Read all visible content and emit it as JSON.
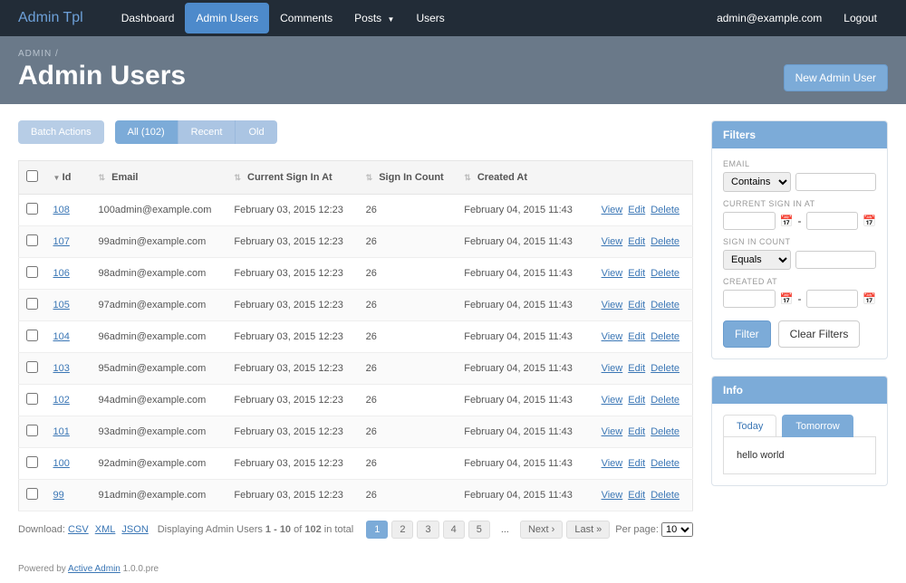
{
  "nav": {
    "brand": "Admin Tpl",
    "items": [
      "Dashboard",
      "Admin Users",
      "Comments",
      "Posts",
      "Users"
    ],
    "active": 1,
    "dropdown_index": 3,
    "user_email": "admin@example.com",
    "logout": "Logout"
  },
  "header": {
    "breadcrumb": "ADMIN  /",
    "title": "Admin Users",
    "new_btn": "New Admin User"
  },
  "scopes": {
    "batch": "Batch Actions",
    "items": [
      "All (102)",
      "Recent",
      "Old"
    ],
    "active": 0
  },
  "table": {
    "cols": [
      "",
      "Id",
      "Email",
      "Current Sign In At",
      "Sign In Count",
      "Created At",
      ""
    ],
    "rows": [
      {
        "id": "108",
        "email": "100admin@example.com",
        "signin_at": "February 03, 2015 12:23",
        "count": "26",
        "created": "February 04, 2015 11:43"
      },
      {
        "id": "107",
        "email": "99admin@example.com",
        "signin_at": "February 03, 2015 12:23",
        "count": "26",
        "created": "February 04, 2015 11:43"
      },
      {
        "id": "106",
        "email": "98admin@example.com",
        "signin_at": "February 03, 2015 12:23",
        "count": "26",
        "created": "February 04, 2015 11:43"
      },
      {
        "id": "105",
        "email": "97admin@example.com",
        "signin_at": "February 03, 2015 12:23",
        "count": "26",
        "created": "February 04, 2015 11:43"
      },
      {
        "id": "104",
        "email": "96admin@example.com",
        "signin_at": "February 03, 2015 12:23",
        "count": "26",
        "created": "February 04, 2015 11:43"
      },
      {
        "id": "103",
        "email": "95admin@example.com",
        "signin_at": "February 03, 2015 12:23",
        "count": "26",
        "created": "February 04, 2015 11:43"
      },
      {
        "id": "102",
        "email": "94admin@example.com",
        "signin_at": "February 03, 2015 12:23",
        "count": "26",
        "created": "February 04, 2015 11:43"
      },
      {
        "id": "101",
        "email": "93admin@example.com",
        "signin_at": "February 03, 2015 12:23",
        "count": "26",
        "created": "February 04, 2015 11:43"
      },
      {
        "id": "100",
        "email": "92admin@example.com",
        "signin_at": "February 03, 2015 12:23",
        "count": "26",
        "created": "February 04, 2015 11:43"
      },
      {
        "id": "99",
        "email": "91admin@example.com",
        "signin_at": "February 03, 2015 12:23",
        "count": "26",
        "created": "February 04, 2015 11:43"
      }
    ],
    "actions": {
      "view": "View",
      "edit": "Edit",
      "delete": "Delete"
    }
  },
  "footer_links": {
    "label": "Download:",
    "csv": "CSV",
    "xml": "XML",
    "json": "JSON"
  },
  "pagination": {
    "info_pre": "Displaying Admin Users ",
    "info_range": "1 - 10",
    "info_mid": " of ",
    "info_total": "102",
    "info_post": " in total",
    "pages": [
      "1",
      "2",
      "3",
      "4",
      "5",
      "...",
      "Next ›",
      "Last »"
    ],
    "current": 0,
    "perpage_label": "Per page:",
    "perpage_value": "10"
  },
  "filters": {
    "title": "Filters",
    "email_label": "EMAIL",
    "email_op": "Contains",
    "signin_label": "CURRENT SIGN IN AT",
    "dash": "-",
    "count_label": "SIGN IN COUNT",
    "count_op": "Equals",
    "created_label": "CREATED AT",
    "filter_btn": "Filter",
    "clear_btn": "Clear Filters"
  },
  "info": {
    "title": "Info",
    "tabs": [
      "Today",
      "Tomorrow"
    ],
    "active": 1,
    "body": "hello world"
  },
  "powered": {
    "pre": "Powered by ",
    "link": "Active Admin",
    "post": " 1.0.0.pre"
  }
}
